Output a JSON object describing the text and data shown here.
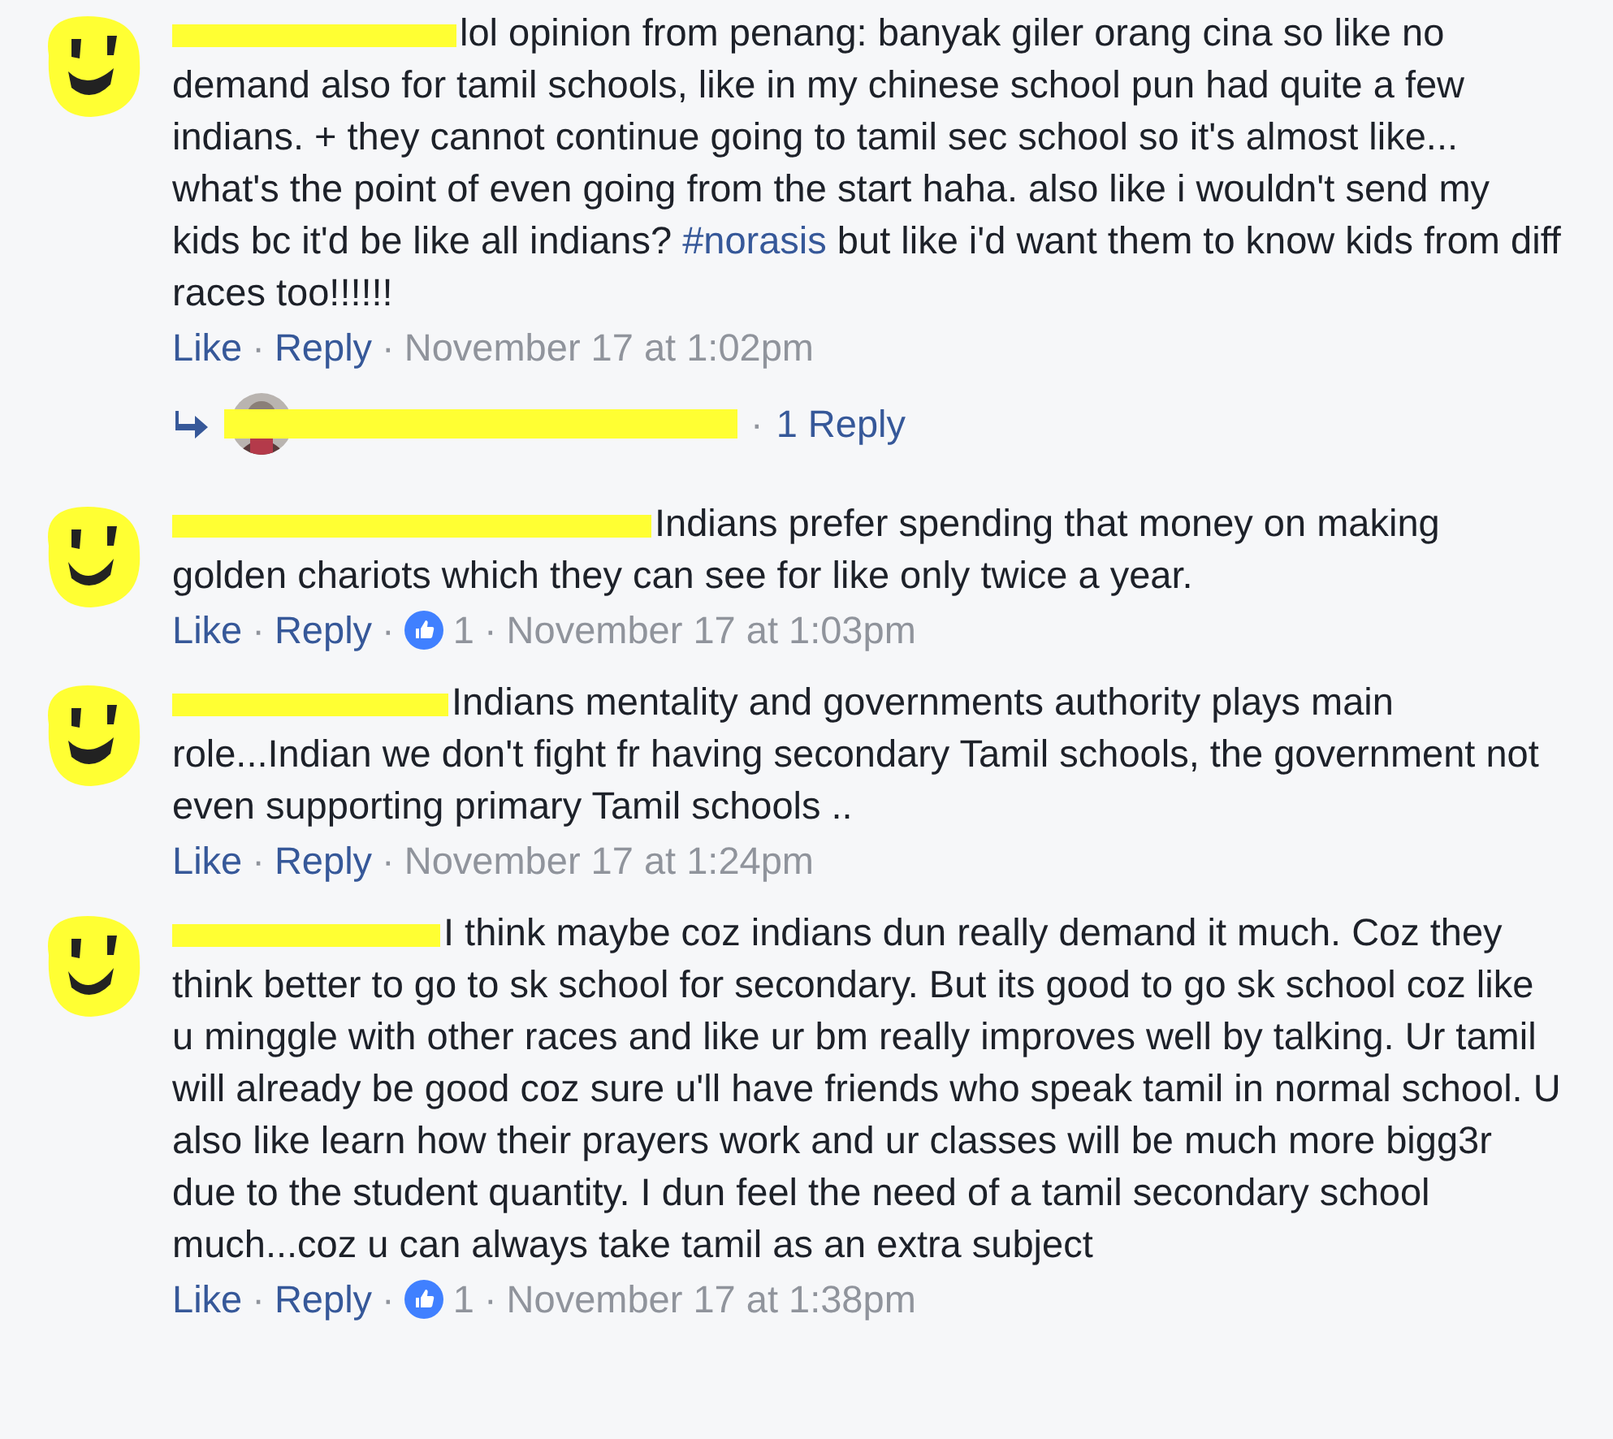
{
  "comments": [
    {
      "segments": [
        {
          "kind": "text",
          "text": "lol opinion from penang: banyak giler orang cina so like no demand also for tamil schools, like in my chinese school pun had quite a few indians. + they cannot continue going to tamil sec school so it's almost like... what's the point of even going from the start haha. also like i wouldn't send my kids bc it'd be like all indians? "
        },
        {
          "kind": "hashtag",
          "text": "#norasis"
        },
        {
          "kind": "text",
          "text": " but like i'd want them to know kids from diff races too!!!!!!"
        }
      ],
      "like": "Like",
      "sep": "·",
      "reply": "Reply",
      "time": "November 17 at 1:02pm",
      "replies": "1 Reply"
    },
    {
      "segments": [
        {
          "kind": "text",
          "text": "Indians prefer spending that money on making golden chariots which they can see for like only twice a year."
        }
      ],
      "like": "Like",
      "sep": "·",
      "reply": "Reply",
      "likes": "1",
      "time": "November 17 at 1:03pm"
    },
    {
      "segments": [
        {
          "kind": "text",
          "text": "Indians mentality and governments authority plays main role...Indian we don't fight fr having secondary Tamil schools, the government not even supporting primary Tamil schools .."
        }
      ],
      "like": "Like",
      "sep": "·",
      "reply": "Reply",
      "time": "November 17 at 1:24pm"
    },
    {
      "segments": [
        {
          "kind": "text",
          "text": "I think maybe coz indians dun really demand it much. Coz they think better to go to sk school for secondary. But its good to go sk school coz like u minggle with other races and like ur bm really improves well by talking. Ur tamil will already be good coz sure u'll have friends who speak tamil in normal school. U also like learn how their prayers work and ur classes will be much more bigg3r due to the student quantity. I dun feel the need of a tamil secondary school much...coz u can always take tamil as an extra subject"
        }
      ],
      "like": "Like",
      "sep": "·",
      "reply": "Reply",
      "likes": "1",
      "time": "November 17 at 1:38pm"
    }
  ]
}
